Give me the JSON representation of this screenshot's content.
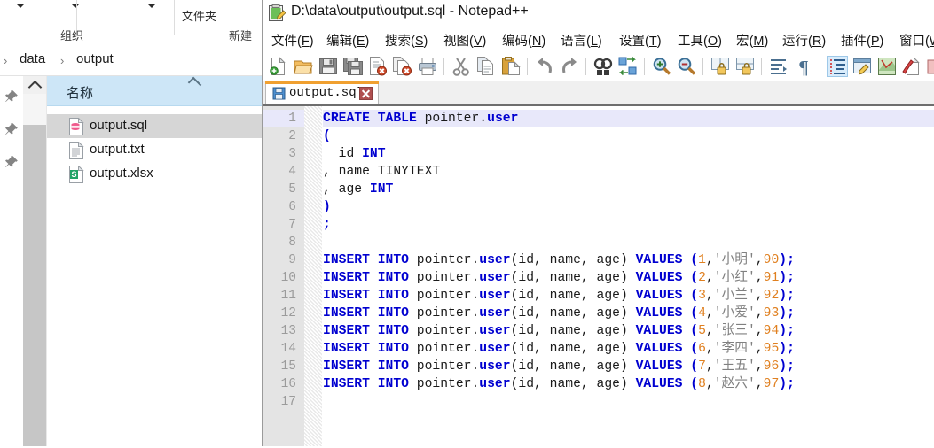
{
  "explorer": {
    "ribbon": {
      "group_organize": "组织",
      "group_new": "新建",
      "new_folder_label": "文件夹"
    },
    "breadcrumb": {
      "sep": "›",
      "items": [
        "data",
        "output"
      ]
    },
    "column_header": "名称",
    "files": [
      {
        "name": "output.sql",
        "icon": "sql-file-icon",
        "selected": true
      },
      {
        "name": "output.txt",
        "icon": "text-file-icon",
        "selected": false
      },
      {
        "name": "output.xlsx",
        "icon": "excel-file-icon",
        "selected": false
      }
    ]
  },
  "npp": {
    "title": "D:\\data\\output\\output.sql - Notepad++",
    "menu": [
      {
        "label": "文件",
        "mnemonic": "F"
      },
      {
        "label": "编辑",
        "mnemonic": "E"
      },
      {
        "label": "搜索",
        "mnemonic": "S"
      },
      {
        "label": "视图",
        "mnemonic": "V"
      },
      {
        "label": "编码",
        "mnemonic": "N"
      },
      {
        "label": "语言",
        "mnemonic": "L"
      },
      {
        "label": "设置",
        "mnemonic": "T"
      },
      {
        "label": "工具",
        "mnemonic": "O"
      },
      {
        "label": "宏",
        "mnemonic": "M"
      },
      {
        "label": "运行",
        "mnemonic": "R"
      },
      {
        "label": "插件",
        "mnemonic": "P"
      },
      {
        "label": "窗口",
        "mnemonic": "W"
      }
    ],
    "toolbar_icons": [
      "new-file-icon",
      "open-file-icon",
      "save-icon",
      "save-all-icon",
      "close-file-icon",
      "close-all-icon",
      "print-icon",
      "cut-icon",
      "copy-icon",
      "paste-icon",
      "undo-icon",
      "redo-icon",
      "find-icon",
      "replace-icon",
      "zoom-in-icon",
      "zoom-out-icon",
      "sync-vertical-scroll-icon",
      "sync-horizontal-scroll-icon",
      "word-wrap-icon",
      "show-all-characters-icon",
      "indent-guide-icon",
      "user-defined-dialog-icon",
      "show-document-map-icon",
      "function-list-icon",
      "folder-as-workspace-icon",
      "monitoring-icon"
    ],
    "tab": {
      "label": "output.sql",
      "icon": "saved-document-icon",
      "close_label": "×"
    },
    "colors": {
      "keyword": "#0000d0",
      "number": "#e08020",
      "string": "#808080",
      "plain": "#1a1a1a",
      "current_line": "#e8e8fa",
      "gutter_bg": "#e4e4e4",
      "tab_accent": "#f0a030",
      "explorer_header": "#cde6f7",
      "selection": "#d6d6d6"
    },
    "editor": {
      "line_count": 17,
      "line_numbers": [
        "1",
        "2",
        "3",
        "4",
        "5",
        "6",
        "7",
        "8",
        "9",
        "10",
        "11",
        "12",
        "13",
        "14",
        "15",
        "16",
        "17"
      ],
      "lines": [
        {
          "n": 1,
          "current": true,
          "tokens": [
            {
              "t": "CREATE TABLE ",
              "c": "kw"
            },
            {
              "t": "pointer",
              "c": "plain"
            },
            {
              "t": ".",
              "c": "plain"
            },
            {
              "t": "user",
              "c": "ent"
            }
          ]
        },
        {
          "n": 2,
          "tokens": [
            {
              "t": "(",
              "c": "op"
            }
          ]
        },
        {
          "n": 3,
          "tokens": [
            {
              "t": "  id ",
              "c": "plain"
            },
            {
              "t": "INT",
              "c": "kw"
            }
          ]
        },
        {
          "n": 4,
          "tokens": [
            {
              "t": ", name TINYTEXT",
              "c": "plain"
            }
          ]
        },
        {
          "n": 5,
          "tokens": [
            {
              "t": ", age ",
              "c": "plain"
            },
            {
              "t": "INT",
              "c": "kw"
            }
          ]
        },
        {
          "n": 6,
          "tokens": [
            {
              "t": ")",
              "c": "op"
            }
          ]
        },
        {
          "n": 7,
          "tokens": [
            {
              "t": ";",
              "c": "op"
            }
          ]
        },
        {
          "n": 8,
          "tokens": []
        },
        {
          "n": 9,
          "tokens": [
            {
              "t": "INSERT INTO ",
              "c": "kw"
            },
            {
              "t": "pointer.",
              "c": "plain"
            },
            {
              "t": "user",
              "c": "ent"
            },
            {
              "t": "(id, name, age) ",
              "c": "plain"
            },
            {
              "t": "VALUES ",
              "c": "kw"
            },
            {
              "t": "(",
              "c": "op"
            },
            {
              "t": "1",
              "c": "num"
            },
            {
              "t": ",",
              "c": "plain"
            },
            {
              "t": "'小明'",
              "c": "str"
            },
            {
              "t": ",",
              "c": "plain"
            },
            {
              "t": "90",
              "c": "num"
            },
            {
              "t": ");",
              "c": "op"
            }
          ]
        },
        {
          "n": 10,
          "tokens": [
            {
              "t": "INSERT INTO ",
              "c": "kw"
            },
            {
              "t": "pointer.",
              "c": "plain"
            },
            {
              "t": "user",
              "c": "ent"
            },
            {
              "t": "(id, name, age) ",
              "c": "plain"
            },
            {
              "t": "VALUES ",
              "c": "kw"
            },
            {
              "t": "(",
              "c": "op"
            },
            {
              "t": "2",
              "c": "num"
            },
            {
              "t": ",",
              "c": "plain"
            },
            {
              "t": "'小红'",
              "c": "str"
            },
            {
              "t": ",",
              "c": "plain"
            },
            {
              "t": "91",
              "c": "num"
            },
            {
              "t": ");",
              "c": "op"
            }
          ]
        },
        {
          "n": 11,
          "tokens": [
            {
              "t": "INSERT INTO ",
              "c": "kw"
            },
            {
              "t": "pointer.",
              "c": "plain"
            },
            {
              "t": "user",
              "c": "ent"
            },
            {
              "t": "(id, name, age) ",
              "c": "plain"
            },
            {
              "t": "VALUES ",
              "c": "kw"
            },
            {
              "t": "(",
              "c": "op"
            },
            {
              "t": "3",
              "c": "num"
            },
            {
              "t": ",",
              "c": "plain"
            },
            {
              "t": "'小兰'",
              "c": "str"
            },
            {
              "t": ",",
              "c": "plain"
            },
            {
              "t": "92",
              "c": "num"
            },
            {
              "t": ");",
              "c": "op"
            }
          ]
        },
        {
          "n": 12,
          "tokens": [
            {
              "t": "INSERT INTO ",
              "c": "kw"
            },
            {
              "t": "pointer.",
              "c": "plain"
            },
            {
              "t": "user",
              "c": "ent"
            },
            {
              "t": "(id, name, age) ",
              "c": "plain"
            },
            {
              "t": "VALUES ",
              "c": "kw"
            },
            {
              "t": "(",
              "c": "op"
            },
            {
              "t": "4",
              "c": "num"
            },
            {
              "t": ",",
              "c": "plain"
            },
            {
              "t": "'小爱'",
              "c": "str"
            },
            {
              "t": ",",
              "c": "plain"
            },
            {
              "t": "93",
              "c": "num"
            },
            {
              "t": ");",
              "c": "op"
            }
          ]
        },
        {
          "n": 13,
          "tokens": [
            {
              "t": "INSERT INTO ",
              "c": "kw"
            },
            {
              "t": "pointer.",
              "c": "plain"
            },
            {
              "t": "user",
              "c": "ent"
            },
            {
              "t": "(id, name, age) ",
              "c": "plain"
            },
            {
              "t": "VALUES ",
              "c": "kw"
            },
            {
              "t": "(",
              "c": "op"
            },
            {
              "t": "5",
              "c": "num"
            },
            {
              "t": ",",
              "c": "plain"
            },
            {
              "t": "'张三'",
              "c": "str"
            },
            {
              "t": ",",
              "c": "plain"
            },
            {
              "t": "94",
              "c": "num"
            },
            {
              "t": ");",
              "c": "op"
            }
          ]
        },
        {
          "n": 14,
          "tokens": [
            {
              "t": "INSERT INTO ",
              "c": "kw"
            },
            {
              "t": "pointer.",
              "c": "plain"
            },
            {
              "t": "user",
              "c": "ent"
            },
            {
              "t": "(id, name, age) ",
              "c": "plain"
            },
            {
              "t": "VALUES ",
              "c": "kw"
            },
            {
              "t": "(",
              "c": "op"
            },
            {
              "t": "6",
              "c": "num"
            },
            {
              "t": ",",
              "c": "plain"
            },
            {
              "t": "'李四'",
              "c": "str"
            },
            {
              "t": ",",
              "c": "plain"
            },
            {
              "t": "95",
              "c": "num"
            },
            {
              "t": ");",
              "c": "op"
            }
          ]
        },
        {
          "n": 15,
          "tokens": [
            {
              "t": "INSERT INTO ",
              "c": "kw"
            },
            {
              "t": "pointer.",
              "c": "plain"
            },
            {
              "t": "user",
              "c": "ent"
            },
            {
              "t": "(id, name, age) ",
              "c": "plain"
            },
            {
              "t": "VALUES ",
              "c": "kw"
            },
            {
              "t": "(",
              "c": "op"
            },
            {
              "t": "7",
              "c": "num"
            },
            {
              "t": ",",
              "c": "plain"
            },
            {
              "t": "'王五'",
              "c": "str"
            },
            {
              "t": ",",
              "c": "plain"
            },
            {
              "t": "96",
              "c": "num"
            },
            {
              "t": ");",
              "c": "op"
            }
          ]
        },
        {
          "n": 16,
          "tokens": [
            {
              "t": "INSERT INTO ",
              "c": "kw"
            },
            {
              "t": "pointer.",
              "c": "plain"
            },
            {
              "t": "user",
              "c": "ent"
            },
            {
              "t": "(id, name, age) ",
              "c": "plain"
            },
            {
              "t": "VALUES ",
              "c": "kw"
            },
            {
              "t": "(",
              "c": "op"
            },
            {
              "t": "8",
              "c": "num"
            },
            {
              "t": ",",
              "c": "plain"
            },
            {
              "t": "'赵六'",
              "c": "str"
            },
            {
              "t": ",",
              "c": "plain"
            },
            {
              "t": "97",
              "c": "num"
            },
            {
              "t": ");",
              "c": "op"
            }
          ]
        },
        {
          "n": 17,
          "tokens": []
        }
      ]
    }
  }
}
